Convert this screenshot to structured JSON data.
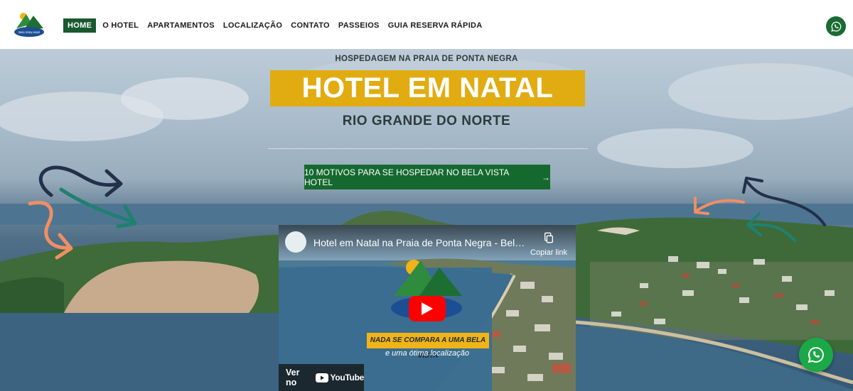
{
  "header": {
    "logo_text": "Bela Vista Hotel",
    "nav": [
      {
        "label": "HOME",
        "active": true
      },
      {
        "label": "O HOTEL",
        "active": false
      },
      {
        "label": "APARTAMENTOS",
        "active": false
      },
      {
        "label": "LOCALIZAÇÃO",
        "active": false
      },
      {
        "label": "CONTATO",
        "active": false
      },
      {
        "label": "PASSEIOS",
        "active": false
      },
      {
        "label": "GUIA RESERVA RÁPIDA",
        "active": false
      }
    ],
    "whatsapp_icon": "whatsapp-icon"
  },
  "hero": {
    "kicker": "HOSPEDAGEM NA PRAIA DE PONTA NEGRA",
    "title": "HOTEL EM NATAL",
    "subtitle": "RIO GRANDE DO NORTE",
    "cta_label": "10 MOTIVOS PARA SE HOSPEDAR NO BELA VISTA HOTEL",
    "cta_icon": "arrow-right-icon"
  },
  "video": {
    "title": "Hotel em Natal na Praia de Ponta Negra - Bela Vista Hotel",
    "copy_label": "Copiar link",
    "banner_text": "NADA SE COMPARA A UMA BELA VISTA",
    "tagline": "e uma ótima localização",
    "watch_label": "Ver no",
    "youtube_label": "YouTube"
  },
  "colors": {
    "brand_green": "#15692f",
    "title_yellow": "#e1ac11",
    "whatsapp_green": "#1ba847",
    "arrow_navy": "#23304a",
    "arrow_teal": "#1f8070",
    "arrow_orange": "#ef8f63"
  }
}
